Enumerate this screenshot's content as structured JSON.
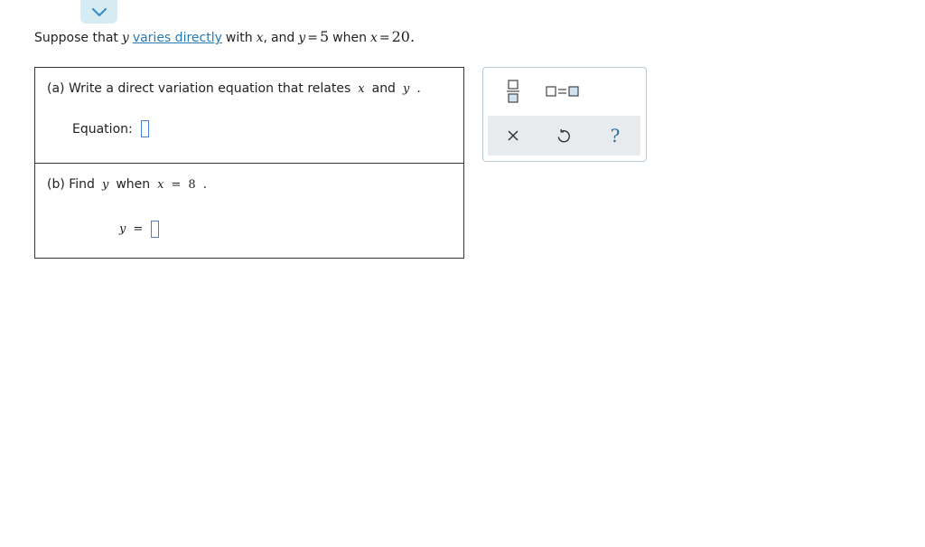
{
  "prompt": {
    "intro": "Suppose that",
    "var_y": "y",
    "link_text": "varies directly",
    "with_text": "with",
    "var_x": "x",
    "comma": ",",
    "and_text": "and",
    "eq1_var": "y",
    "eq_sign": "=",
    "eq1_val": "5",
    "when_text": "when",
    "eq2_var": "x",
    "eq2_val": "20",
    "period": "."
  },
  "part_a": {
    "label": "(a) Write a direct variation equation that relates",
    "var_x": "x",
    "and_text": "and",
    "var_y": "y",
    "period": ".",
    "answer_label": "Equation:"
  },
  "part_b": {
    "label": "(b) Find",
    "var_y": "y",
    "when_text": "when",
    "var_x": "x",
    "eq_sign": "=",
    "value": "8",
    "period": ".",
    "answer_var": "y",
    "answer_eq": "="
  },
  "toolbar": {
    "tools": [
      "fraction-icon",
      "equation-template-icon"
    ],
    "actions": [
      "clear-icon",
      "undo-icon",
      "help-icon"
    ],
    "help_glyph": "?"
  },
  "colors": {
    "link": "#2779b5",
    "answer_box": "#4a7fd4",
    "collapse_tab": "#d6ecf3",
    "action_bar": "#e8ebee",
    "toolbar_border": "#b9c9d3"
  }
}
